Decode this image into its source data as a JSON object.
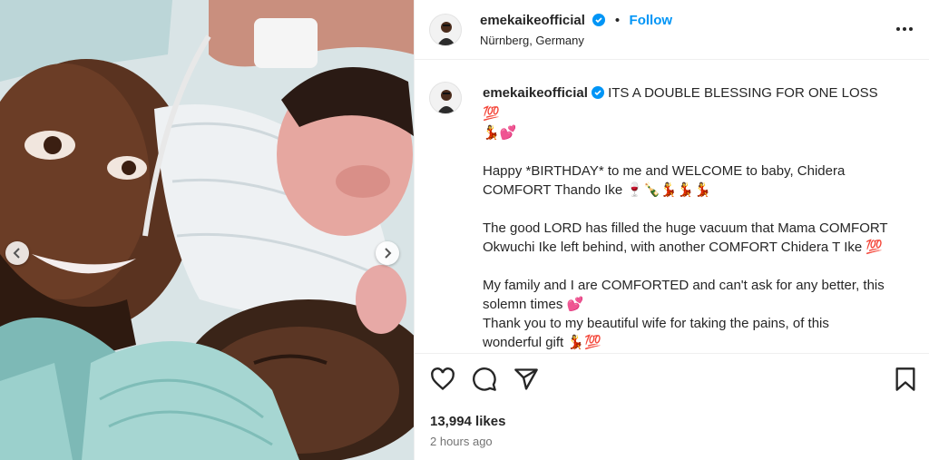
{
  "post": {
    "username": "emekaikeofficial",
    "follow_label": "Follow",
    "separator": "•",
    "location": "Nürnberg, Germany"
  },
  "caption": {
    "username": "emekaikeofficial",
    "line1": "ITS A DOUBLE BLESSING FOR ONE LOSS 💯",
    "line1b": "💃💕",
    "para2": "Happy *BIRTHDAY* to me and WELCOME to baby, Chidera COMFORT Thando Ike 🍷🍾💃💃💃",
    "para3": "The good LORD has filled the huge vacuum that Mama COMFORT Okwuchi Ike left behind, with another COMFORT Chidera T Ike 💯",
    "para4a": "My family and I are COMFORTED and can't ask for any better, this solemn times 💕",
    "para4b": "Thank you to my beautiful wife for taking the pains, of this wonderful gift 💃💯"
  },
  "footer": {
    "likes": "13,994 likes",
    "time": "2 hours ago"
  },
  "colors": {
    "accent": "#0095f6",
    "text": "#262626",
    "muted": "#737373"
  },
  "icons": [
    "heart-icon",
    "comment-icon",
    "share-icon",
    "bookmark-icon",
    "more-icon",
    "verified-icon",
    "chevron-left-icon",
    "chevron-right-icon"
  ]
}
